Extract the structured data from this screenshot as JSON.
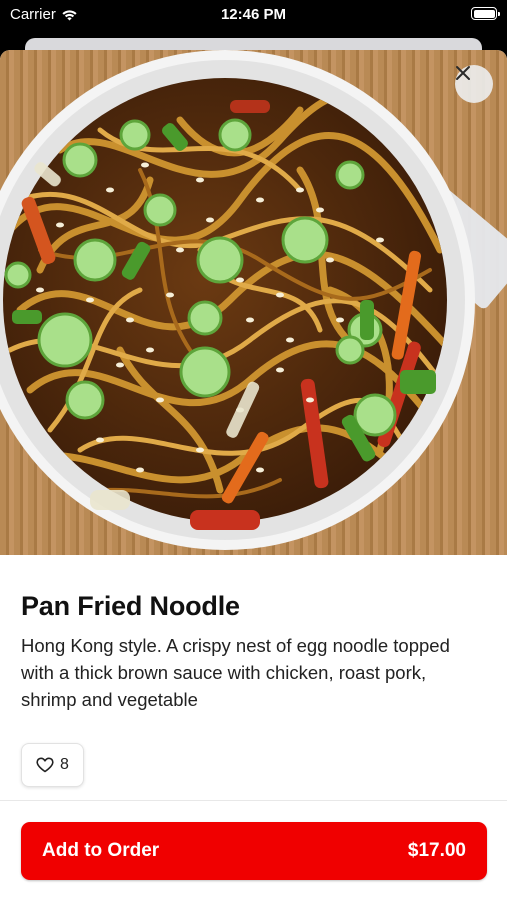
{
  "status_bar": {
    "carrier": "Carrier",
    "time": "12:46 PM"
  },
  "item": {
    "name": "Pan Fried Noodle",
    "description": "Hong Kong style. A crispy nest of egg noodle topped with a thick brown sauce with chicken, roast pork, shrimp and vegetable",
    "like_count": "8"
  },
  "order_button": {
    "label": "Add to Order",
    "price": "$17.00"
  },
  "colors": {
    "accent": "#f00000",
    "bowl": "#ffffff",
    "noodle": "#c9902e",
    "scallion": "#8fd06a",
    "pepper": "#c8321e"
  },
  "icons": {
    "close": "close-icon",
    "heart": "heart-icon",
    "wifi": "wifi-icon",
    "battery": "battery-icon"
  }
}
